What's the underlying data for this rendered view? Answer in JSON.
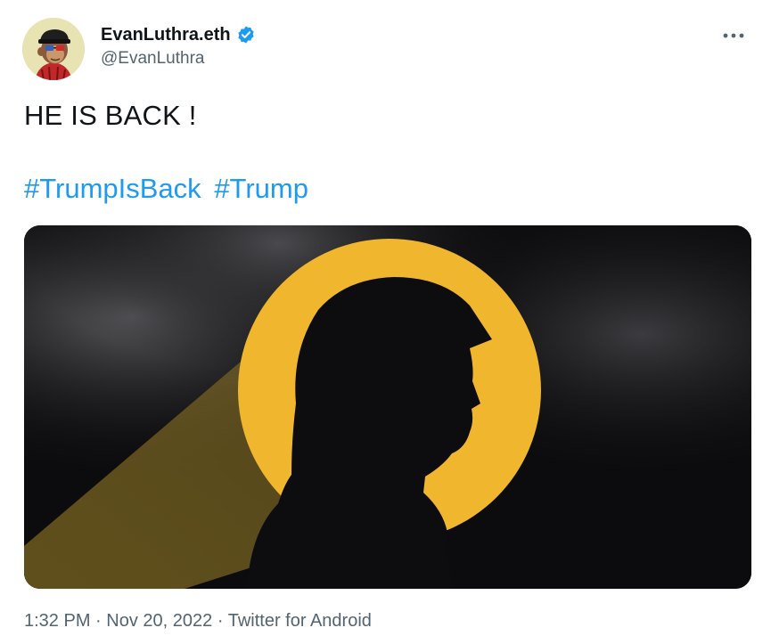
{
  "author": {
    "display_name": "EvanLuthra.eth",
    "handle": "@EvanLuthra",
    "verified": true
  },
  "tweet": {
    "text": "HE IS BACK !",
    "hashtags": [
      "#TrumpIsBack",
      "#Trump"
    ]
  },
  "meta": {
    "time": "1:32 PM",
    "separator": "·",
    "date": "Nov 20, 2022",
    "source": "Twitter for Android"
  },
  "icons": {
    "more": "more-horizontal-icon",
    "verified": "verified-badge-icon"
  },
  "colors": {
    "link": "#1d9bf0",
    "verified": "#1d9bf0",
    "secondary_text": "#536471",
    "primary_text": "#0f1419",
    "media_gold": "#f0b62d"
  }
}
